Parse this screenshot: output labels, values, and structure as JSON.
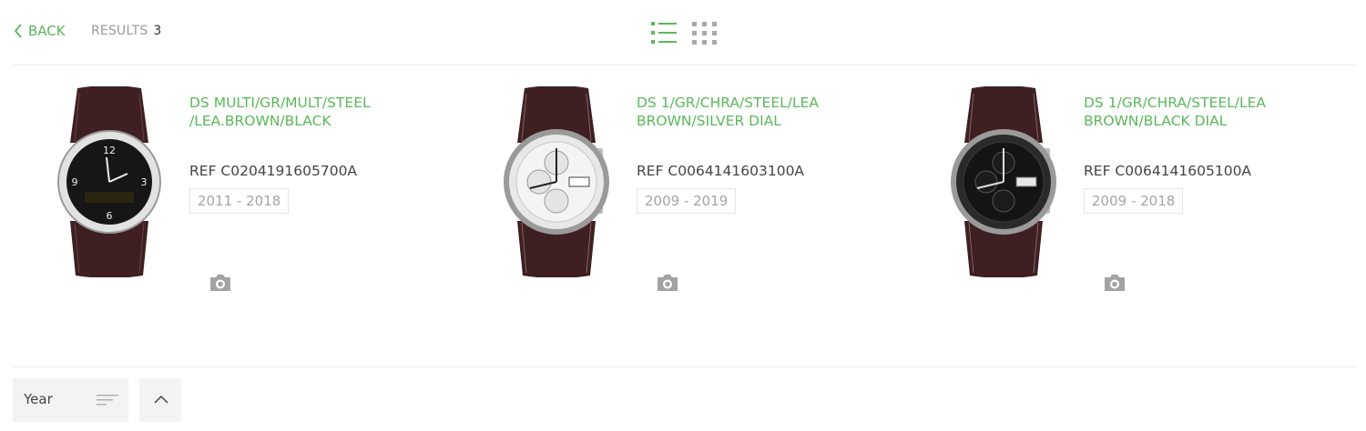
{
  "toolbar": {
    "back_label": "BACK",
    "results_label": "RESULTS",
    "results_count": "3",
    "view_list_icon": "list-view-icon",
    "view_grid_icon": "grid-view-icon",
    "accent_color": "#5cb85c"
  },
  "products": [
    {
      "title_line1": "DS MULTI/GR/MULT/STEEL",
      "title_line2": "/LEA.BROWN/BLACK",
      "ref": "REF C0204191605700A",
      "years": "2011 - 2018",
      "dial": "black-digital",
      "image_icon": "camera-icon"
    },
    {
      "title_line1": "DS 1/GR/CHRA/STEEL/LEA",
      "title_line2": "BROWN/SILVER DIAL",
      "ref": "REF C0064141603100A",
      "years": "2009 - 2019",
      "dial": "silver-chrono",
      "image_icon": "camera-icon"
    },
    {
      "title_line1": "DS 1/GR/CHRA/STEEL/LEA",
      "title_line2": "BROWN/BLACK DIAL",
      "ref": "REF C0064141605100A",
      "years": "2009 - 2018",
      "dial": "black-chrono",
      "image_icon": "camera-icon"
    }
  ],
  "sort": {
    "label": "Year",
    "icon": "sort-lines-icon",
    "toggle_icon": "chevron-up-icon"
  }
}
